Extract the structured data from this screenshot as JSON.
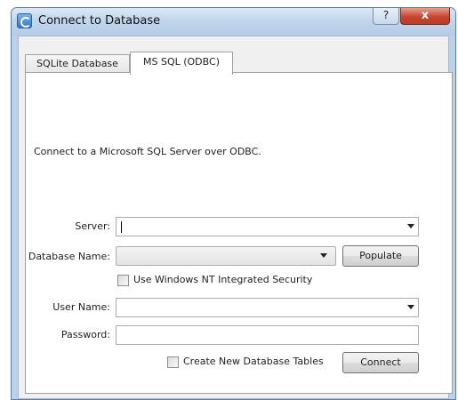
{
  "window": {
    "title": "Connect to Database",
    "help_label": "?",
    "close_label": "x"
  },
  "tabs": [
    {
      "label": "SQLite Database",
      "selected": false
    },
    {
      "label": "MS SQL (ODBC)",
      "selected": true
    }
  ],
  "form": {
    "description": "Connect to a Microsoft SQL Server over ODBC.",
    "server_label": "Server:",
    "server_value": "",
    "database_label": "Database Name:",
    "database_value": "",
    "populate_label": "Populate",
    "integrated_security_label": "Use Windows NT Integrated Security",
    "integrated_security_checked": false,
    "username_label": "User Name:",
    "username_value": "",
    "password_label": "Password:",
    "password_value": "",
    "create_tables_label": "Create New Database Tables",
    "create_tables_checked": false,
    "connect_label": "Connect"
  }
}
